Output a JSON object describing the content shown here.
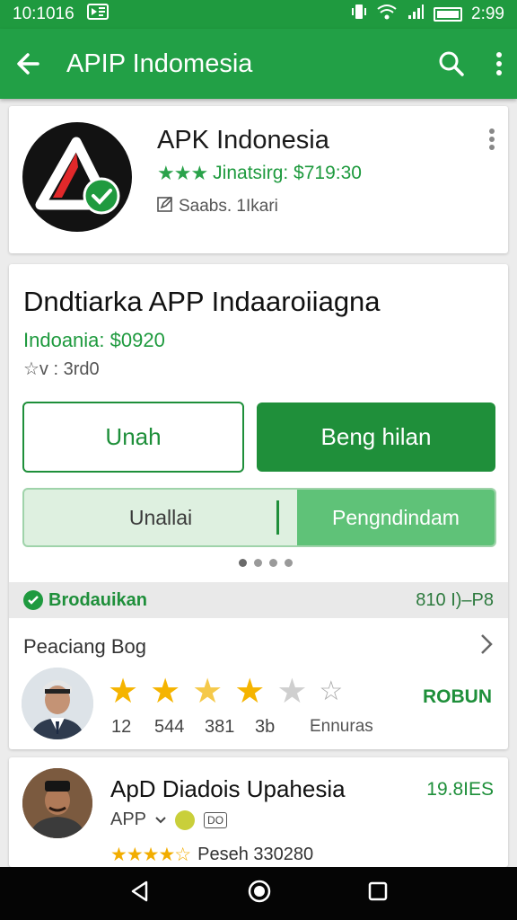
{
  "status_bar": {
    "time": "10:1016",
    "clock": "2:99"
  },
  "app_bar": {
    "title": "APIP Indomesia"
  },
  "header": {
    "app_name": "APK Indonesia",
    "stars": "★★★",
    "rating_text": "Jinatsirg: $719:30",
    "sub_text": "Saabs. 1Ikari"
  },
  "detail": {
    "title": "Dndtiarka APP Indaaroiiagna",
    "price": "Indoania: $0920",
    "meta": "☆v : 3rd0",
    "btn_outline": "Unah",
    "btn_fill": "Beng hilan",
    "toggle_left": "Unallai",
    "toggle_right": "Pengndindam",
    "section_label": "Brodauikan",
    "section_count": "810 I)–P8",
    "review_label": "Peaciang Bog",
    "rating_nums": [
      "12",
      "544",
      "381",
      "3b"
    ],
    "rating_extra": "Ennuras",
    "rating_action": "ROBUN",
    "rating_level": 3.5
  },
  "bottom": {
    "name": "ApD Diadois Upahesia",
    "size": "19.8IES",
    "tag": "APP",
    "badge_text": "DO",
    "stars": "★★★★☆",
    "rating_text": "Peseh 330280"
  },
  "colors": {
    "primary": "#22a046",
    "dark_green": "#1e8f3a",
    "star_yellow": "#f5b400"
  }
}
